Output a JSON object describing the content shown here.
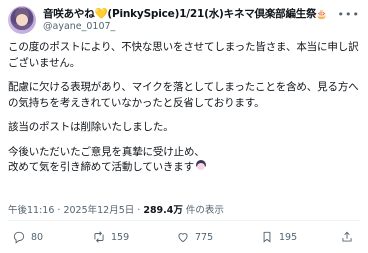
{
  "author": {
    "display_name_prefix": "音咲あやね",
    "heart": "💛",
    "display_name_suffix": "(PinkySpice)1/21(水)キネマ倶楽部編生祭",
    "cake": "🎂",
    "handle": "@ayane_0107_"
  },
  "tweet": {
    "para1": "この度のポストにより、不快な思いをさせてしまった皆さま、本当に申し訳ございません。",
    "para2": "配慮に欠ける表現があり、マイクを落としてしまったことを含め、見る方への気持ちを考えきれていなかったと反省しております。",
    "para3": "該当のポストは削除いたしました。",
    "para4_line1": "今後いただいたご意見を真摯に受け止め、",
    "para4_line2": "改めて気を引き締めて活動していきます"
  },
  "meta": {
    "time": "午後11:16",
    "sep1": " · ",
    "date": "2025年12月5日",
    "sep2": " · ",
    "views_count": "289.4万",
    "views_label": " 件の表示"
  },
  "actions": {
    "reply_count": "80",
    "retweet_count": "159",
    "like_count": "775",
    "bookmark_count": "195"
  },
  "icons": [
    "more-icon",
    "reply-icon",
    "retweet-icon",
    "like-icon",
    "bookmark-icon",
    "share-icon"
  ]
}
